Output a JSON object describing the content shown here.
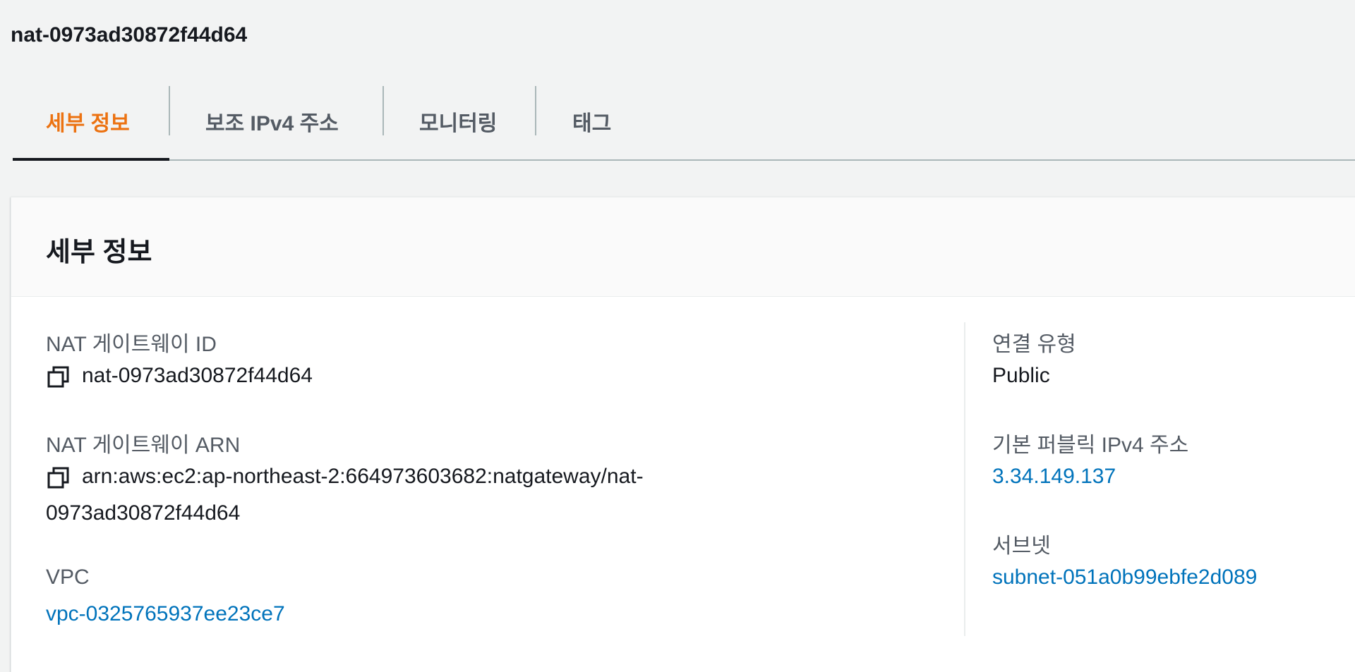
{
  "page": {
    "title": "nat-0973ad30872f44d64"
  },
  "tabs": [
    {
      "label": "세부 정보",
      "active": true
    },
    {
      "label": "보조 IPv4 주소",
      "active": false
    },
    {
      "label": "모니터링",
      "active": false
    },
    {
      "label": "태그",
      "active": false
    }
  ],
  "details": {
    "title": "세부 정보",
    "nat_gateway_id": {
      "label": "NAT 게이트웨이 ID",
      "value": "nat-0973ad30872f44d64"
    },
    "nat_gateway_arn": {
      "label": "NAT 게이트웨이 ARN",
      "value_line1": "arn:aws:ec2:ap-northeast-2:664973603682:natgateway/nat-",
      "value_line2": "0973ad30872f44d64"
    },
    "vpc": {
      "label": "VPC",
      "value": "vpc-0325765937ee23ce7"
    },
    "connectivity_type": {
      "label": "연결 유형",
      "value": "Public"
    },
    "primary_public_ipv4": {
      "label": "기본 퍼블릭 IPv4 주소",
      "value": "3.34.149.137"
    },
    "subnet": {
      "label": "서브넷",
      "value": "subnet-051a0b99ebfe2d089"
    }
  },
  "icons": {
    "copy": "copy-icon"
  },
  "colors": {
    "active_tab": "#ec7211",
    "link": "#0073bb",
    "text": "#16191f",
    "label": "#545b64"
  }
}
